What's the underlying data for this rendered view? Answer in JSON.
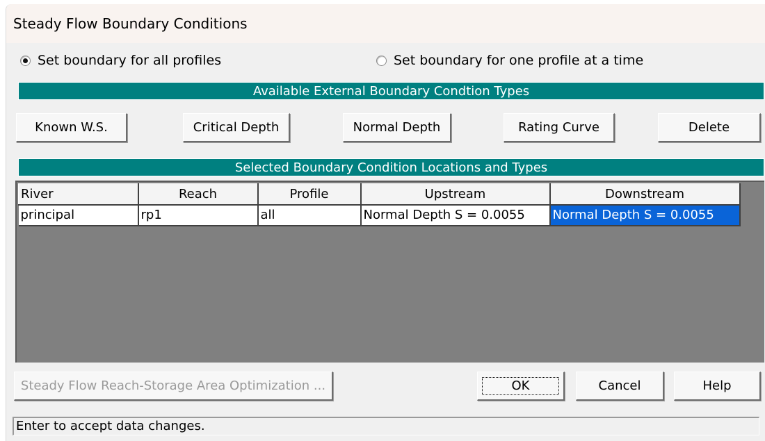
{
  "window": {
    "title": "Steady Flow Boundary Conditions"
  },
  "mode": {
    "all_profiles_label": "Set boundary for all profiles",
    "one_profile_label": "Set boundary for one profile at a time",
    "selected": "all_profiles"
  },
  "types_header": "Available External Boundary Condtion Types",
  "type_buttons": {
    "known_ws": "Known W.S.",
    "critical_depth": "Critical Depth",
    "normal_depth": "Normal Depth",
    "rating_curve": "Rating Curve",
    "delete": "Delete"
  },
  "locations_header": "Selected Boundary Condition Locations and Types",
  "grid": {
    "columns": [
      "River",
      "Reach",
      "Profile",
      "Upstream",
      "Downstream"
    ],
    "rows": [
      {
        "river": "principal",
        "reach": "rp1",
        "profile": "all",
        "upstream": "Normal Depth S = 0.0055",
        "downstream": "Normal Depth S = 0.0055"
      }
    ]
  },
  "bottom_buttons": {
    "optimization": "Steady Flow Reach-Storage Area Optimization ...",
    "ok": "OK",
    "cancel": "Cancel",
    "help": "Help"
  },
  "status_text": "Enter to accept data changes."
}
